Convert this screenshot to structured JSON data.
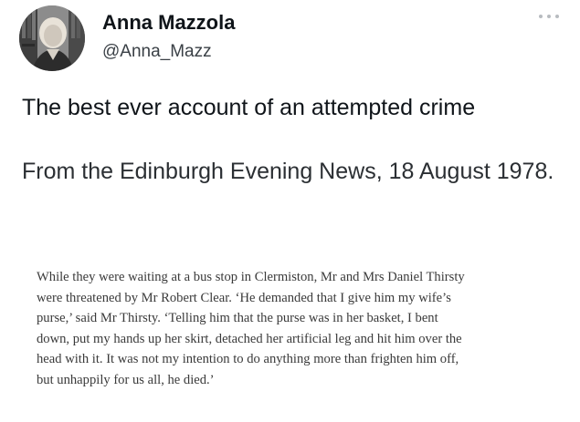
{
  "author": {
    "display_name": "Anna Mazzola",
    "handle": "@Anna_Mazz",
    "avatar_icon": "profile-photo"
  },
  "more_icon": "more-horizontal-icon",
  "tweet_text": "The best ever account of an attempted crime",
  "quote_heading": "From the Edinburgh Evening News, 18 August 1978.",
  "clipping_lines": [
    "While they were waiting at a bus stop in Clermiston, Mr and Mrs Daniel Thirsty",
    "were threatened by Mr Robert Clear. ‘He demanded that I give him my wife’s",
    "purse,’ said Mr Thirsty. ‘Telling him that the purse was in her basket, I bent",
    "down, put my hands up her skirt, detached her artificial leg and hit him over the",
    "head with it. It was not my intention to do anything more than frighten him off,",
    "but unhappily for us all, he died.’"
  ],
  "colors": {
    "text_primary": "#0f1419",
    "text_secondary": "#3a4046",
    "clipping_text": "#3a3a3a",
    "background": "#ffffff"
  }
}
